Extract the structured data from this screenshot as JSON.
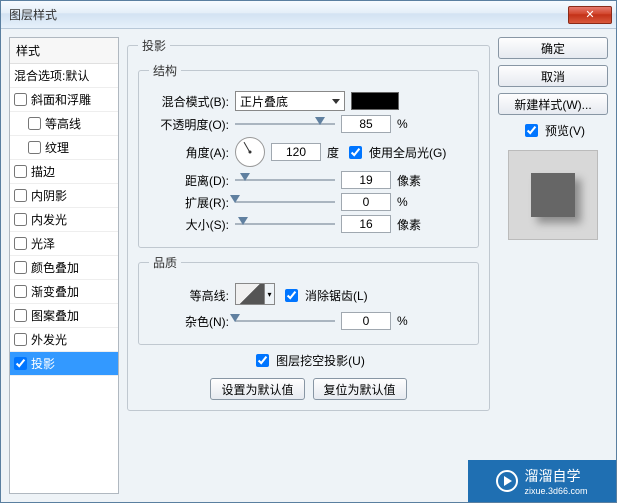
{
  "window": {
    "title": "图层样式"
  },
  "sidebar": {
    "header": "样式",
    "blend": "混合选项:默认",
    "items": [
      {
        "label": "斜面和浮雕",
        "checked": false
      },
      {
        "label": "等高线",
        "checked": false,
        "indent": true
      },
      {
        "label": "纹理",
        "checked": false,
        "indent": true
      },
      {
        "label": "描边",
        "checked": false
      },
      {
        "label": "内阴影",
        "checked": false
      },
      {
        "label": "内发光",
        "checked": false
      },
      {
        "label": "光泽",
        "checked": false
      },
      {
        "label": "颜色叠加",
        "checked": false
      },
      {
        "label": "渐变叠加",
        "checked": false
      },
      {
        "label": "图案叠加",
        "checked": false
      },
      {
        "label": "外发光",
        "checked": false
      },
      {
        "label": "投影",
        "checked": true,
        "selected": true
      }
    ]
  },
  "panel": {
    "title": "投影",
    "structure": {
      "legend": "结构",
      "blend_label": "混合模式(B):",
      "blend_value": "正片叠底",
      "opacity_label": "不透明度(O):",
      "opacity_value": "85",
      "opacity_unit": "%",
      "angle_label": "角度(A):",
      "angle_value": "120",
      "angle_unit": "度",
      "global_light": "使用全局光(G)",
      "distance_label": "距离(D):",
      "distance_value": "19",
      "distance_unit": "像素",
      "spread_label": "扩展(R):",
      "spread_value": "0",
      "spread_unit": "%",
      "size_label": "大小(S):",
      "size_value": "16",
      "size_unit": "像素"
    },
    "quality": {
      "legend": "品质",
      "contour_label": "等高线:",
      "antialias": "消除锯齿(L)",
      "noise_label": "杂色(N):",
      "noise_value": "0",
      "noise_unit": "%"
    },
    "knockout": "图层挖空投影(U)",
    "reset_default": "设置为默认值",
    "revert_default": "复位为默认值"
  },
  "buttons": {
    "ok": "确定",
    "cancel": "取消",
    "new_style": "新建样式(W)...",
    "preview": "预览(V)"
  },
  "watermark": {
    "main": "溜溜自学",
    "sub": "zixue.3d66.com"
  }
}
